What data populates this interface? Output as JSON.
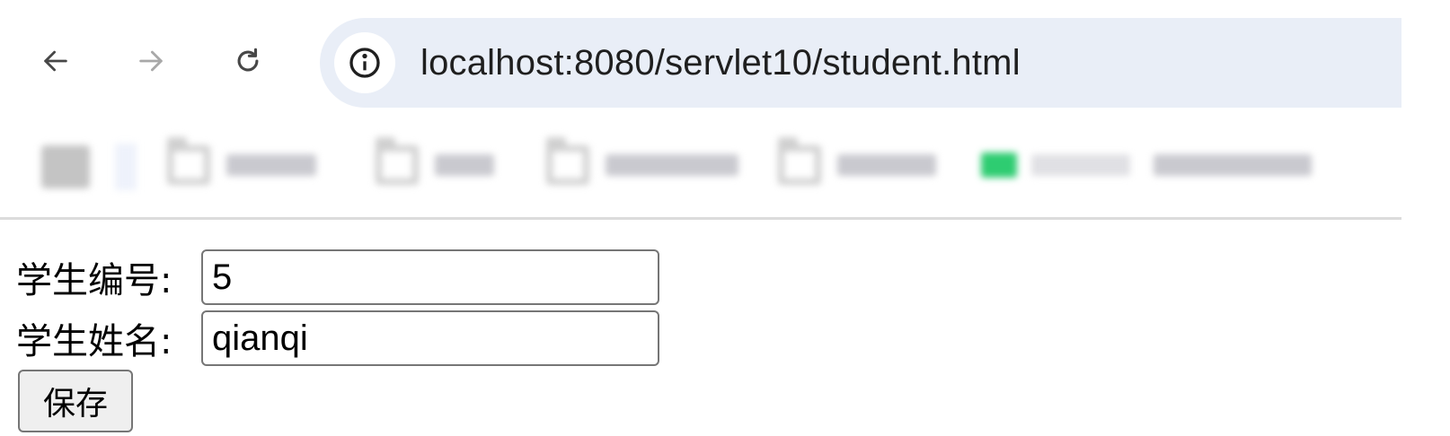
{
  "browser": {
    "url": "localhost:8080/servlet10/student.html"
  },
  "icons": {
    "back": "arrow-left-icon",
    "forward": "arrow-right-icon",
    "reload": "reload-icon",
    "site_info": "info-circle-icon",
    "bookmark_folder": "folder-icon"
  },
  "colors": {
    "omnibox_bg": "#e9eef7",
    "bookmark_green": "#2ecc71"
  },
  "form": {
    "id_label": "学生编号:",
    "id_value": "5",
    "name_label": "学生姓名:",
    "name_value": "qianqi",
    "save_label": "保存"
  }
}
